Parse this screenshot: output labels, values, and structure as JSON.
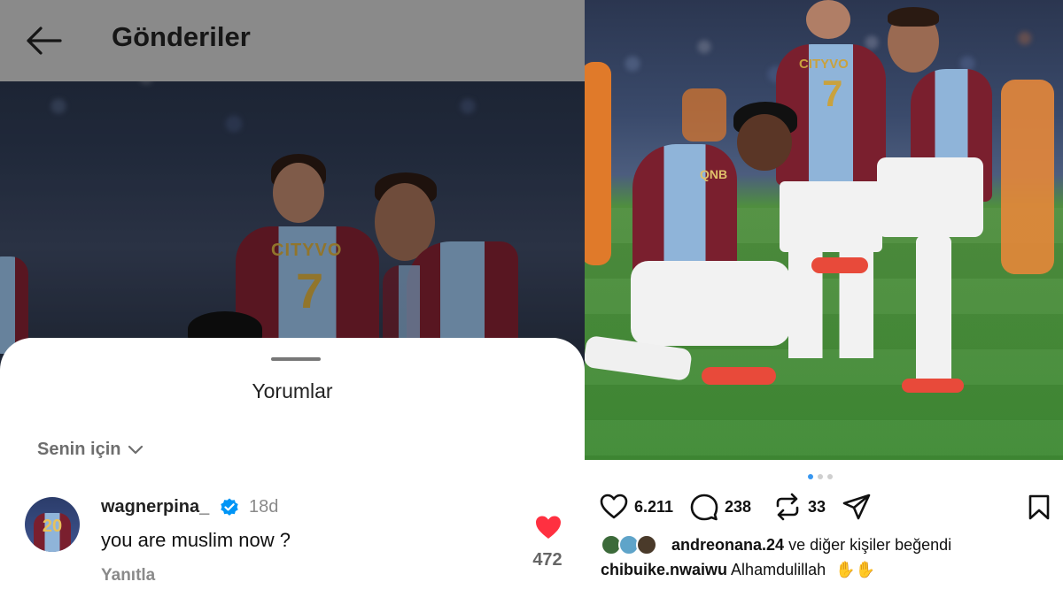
{
  "left_panel": {
    "header": {
      "title": "Gönderiler",
      "back_icon": "arrow-left-icon"
    },
    "post_image": {
      "jersey_sponsor": "CITYVO",
      "jersey_number": "7"
    },
    "comments_sheet": {
      "title": "Yorumlar",
      "sort_label": "Senin için",
      "sort_icon": "chevron-down-icon",
      "comment": {
        "username": "wagnerpina_",
        "verified": true,
        "time": "18d",
        "text": "you are muslim now ?",
        "reply_label": "Yanıtla",
        "like_count": "472",
        "liked": true,
        "avatar_number": "20"
      }
    }
  },
  "right_panel": {
    "post_image": {
      "jersey_sponsor": "CITYVO",
      "jersey_number": "7",
      "sponsor_qnb": "QNB"
    },
    "carousel": {
      "total": 3,
      "active": 1
    },
    "actions": {
      "likes": "6.211",
      "comments": "238",
      "reposts": "33"
    },
    "liked_by": {
      "user": "andreonana.24",
      "suffix": "ve diğer kişiler beğendi"
    },
    "caption": {
      "user": "chibuike.nwaiwu",
      "text": "Alhamdulillah"
    },
    "colors": {
      "heart_red": "#ff3040",
      "verified_blue": "#0095f6",
      "trabzon_claret": "#7a1f2e",
      "trabzon_blue": "#8fb4d9"
    }
  }
}
